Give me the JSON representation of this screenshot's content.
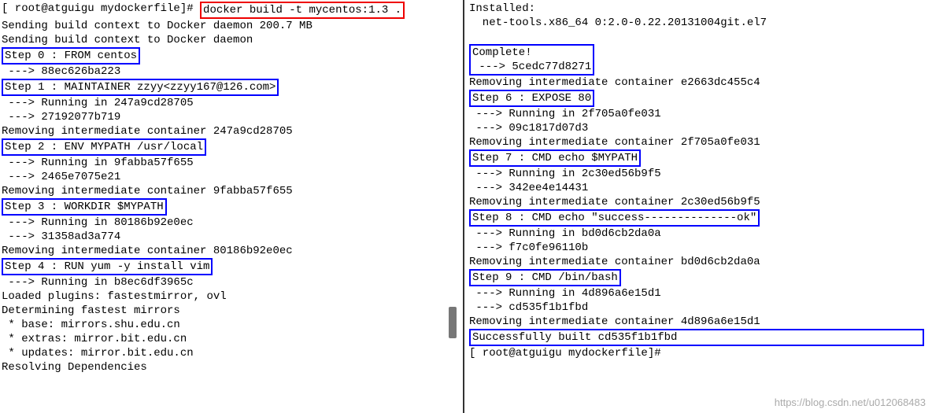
{
  "left": {
    "prompt": "[ root@atguigu mydockerfile]# ",
    "command": "docker build -t mycentos:1.3 .",
    "lines_pre": [
      "Sending build context to Docker daemon 200.7 MB",
      "Sending build context to Docker daemon"
    ],
    "step0": "Step 0 : FROM centos",
    "after_step0": [
      " ---> 88ec626ba223"
    ],
    "step1": "Step 1 : MAINTAINER zzyy<zzyy167@126.com>",
    "after_step1": [
      " ---> Running in 247a9cd28705",
      " ---> 27192077b719",
      "Removing intermediate container 247a9cd28705"
    ],
    "step2": "Step 2 : ENV MYPATH /usr/local",
    "after_step2": [
      " ---> Running in 9fabba57f655",
      " ---> 2465e7075e21",
      "Removing intermediate container 9fabba57f655"
    ],
    "step3": "Step 3 : WORKDIR $MYPATH",
    "after_step3": [
      " ---> Running in 80186b92e0ec",
      " ---> 31358ad3a774",
      "Removing intermediate container 80186b92e0ec"
    ],
    "step4": "Step 4 : RUN yum -y install vim",
    "after_step4": [
      " ---> Running in b8ec6df3965c",
      "Loaded plugins: fastestmirror, ovl",
      "Determining fastest mirrors",
      " * base: mirrors.shu.edu.cn",
      " * extras: mirror.bit.edu.cn",
      " * updates: mirror.bit.edu.cn",
      "Resolving Dependencies"
    ]
  },
  "right": {
    "installed_header": "Installed:",
    "installed_line": "  net-tools.x86_64 0:2.0-0.22.20131004git.el7",
    "complete_box": "Complete!\n ---> 5cedc77d8271",
    "after_complete": [
      "Removing intermediate container e2663dc455c4"
    ],
    "step6": "Step 6 : EXPOSE 80",
    "after_step6": [
      " ---> Running in 2f705a0fe031",
      " ---> 09c1817d07d3",
      "Removing intermediate container 2f705a0fe031"
    ],
    "step7": "Step 7 : CMD echo $MYPATH",
    "after_step7": [
      " ---> Running in 2c30ed56b9f5",
      " ---> 342ee4e14431",
      "Removing intermediate container 2c30ed56b9f5"
    ],
    "step8": "Step 8 : CMD echo \"success--------------ok\"",
    "after_step8": [
      " ---> Running in bd0d6cb2da0a",
      " ---> f7c0fe96110b",
      "Removing intermediate container bd0d6cb2da0a"
    ],
    "step9": "Step 9 : CMD /bin/bash",
    "after_step9": [
      " ---> Running in 4d896a6e15d1",
      " ---> cd535f1b1fbd",
      "Removing intermediate container 4d896a6e15d1"
    ],
    "success": "Successfully built cd535f1b1fbd",
    "prompt_end": "[ root@atguigu mydockerfile]# "
  },
  "watermark": "https://blog.csdn.net/u012068483"
}
